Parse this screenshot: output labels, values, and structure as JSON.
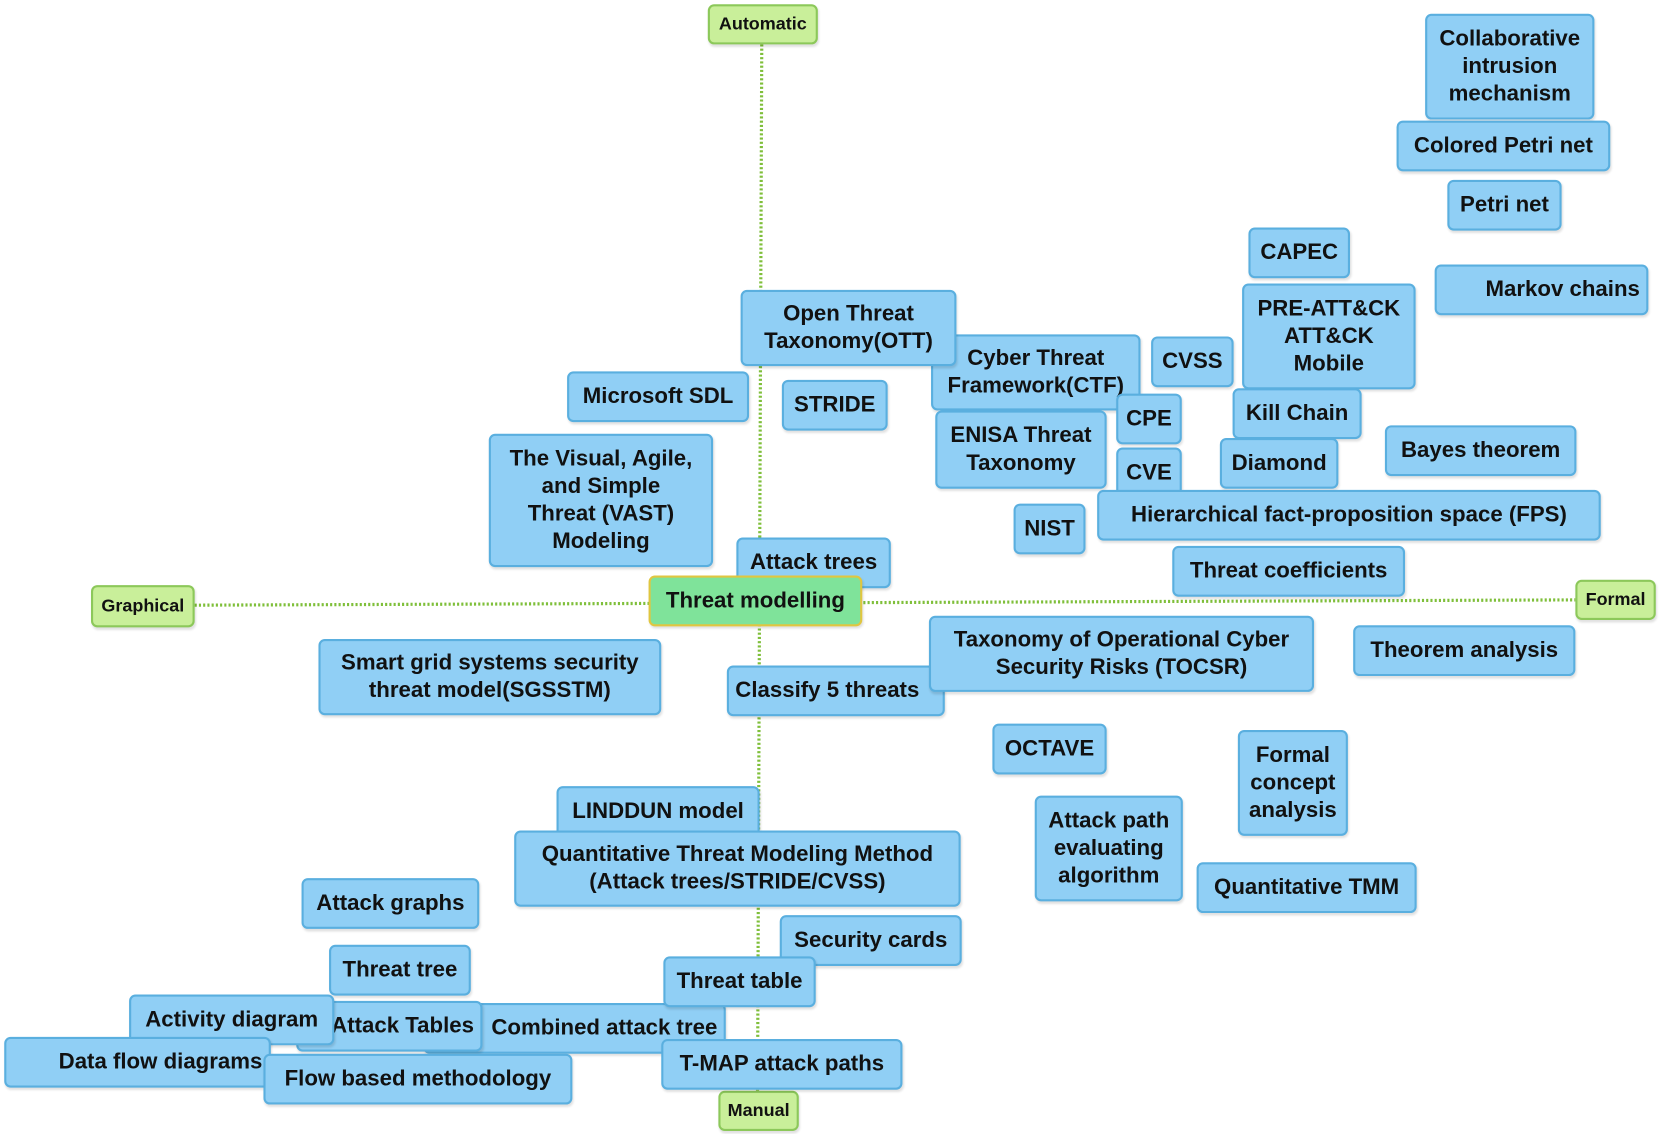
{
  "center": "Threat modelling",
  "axes": {
    "top": "Automatic",
    "bottom": "Manual",
    "left": "Graphical",
    "right": "Formal"
  },
  "colors": {
    "node": "#90cff5",
    "node_border": "#5aafdf",
    "axis": "#c9ef9a",
    "center": "#7fe39a",
    "line": "#7fbf3a"
  },
  "nodes": [
    "Collaborative\nintrusion\nmechanism",
    "Colored Petri net",
    "Petri net",
    "CAPEC",
    "Markov chains",
    "PRE-ATT&CK\nATT&CK\nMobile",
    "Cyber Threat\nFramework(CTF)",
    "Open Threat\nTaxonomy(OTT)",
    "CVSS",
    "Microsoft SDL",
    "STRIDE",
    "CPE",
    "Kill Chain",
    "ENISA Threat\nTaxonomy",
    "Diamond",
    "Bayes theorem",
    "CVE",
    "The Visual, Agile,\nand Simple\nThreat (VAST)\nModeling",
    "Hierarchical fact-proposition space (FPS)",
    "NIST",
    "Attack trees",
    "Threat coefficients",
    "Classify 5 threats",
    "Taxonomy of Operational Cyber\nSecurity Risks (TOCSR)",
    "Theorem analysis",
    "Smart grid systems security\nthreat model(SGSSTM)",
    "OCTAVE",
    "Formal\nconcept\nanalysis",
    "LINDDUN model",
    "Quantitative Threat Modeling Method\n(Attack trees/STRIDE/CVSS)",
    "Attack path\nevaluating\nalgorithm",
    "Attack graphs",
    "Quantitative TMM",
    "Security cards",
    "Threat tree",
    "Combined attack tree",
    "Threat table",
    "Attack Tables",
    "Activity diagram",
    "Data flow diagrams",
    "Flow based methodology",
    "T-MAP attack paths"
  ]
}
